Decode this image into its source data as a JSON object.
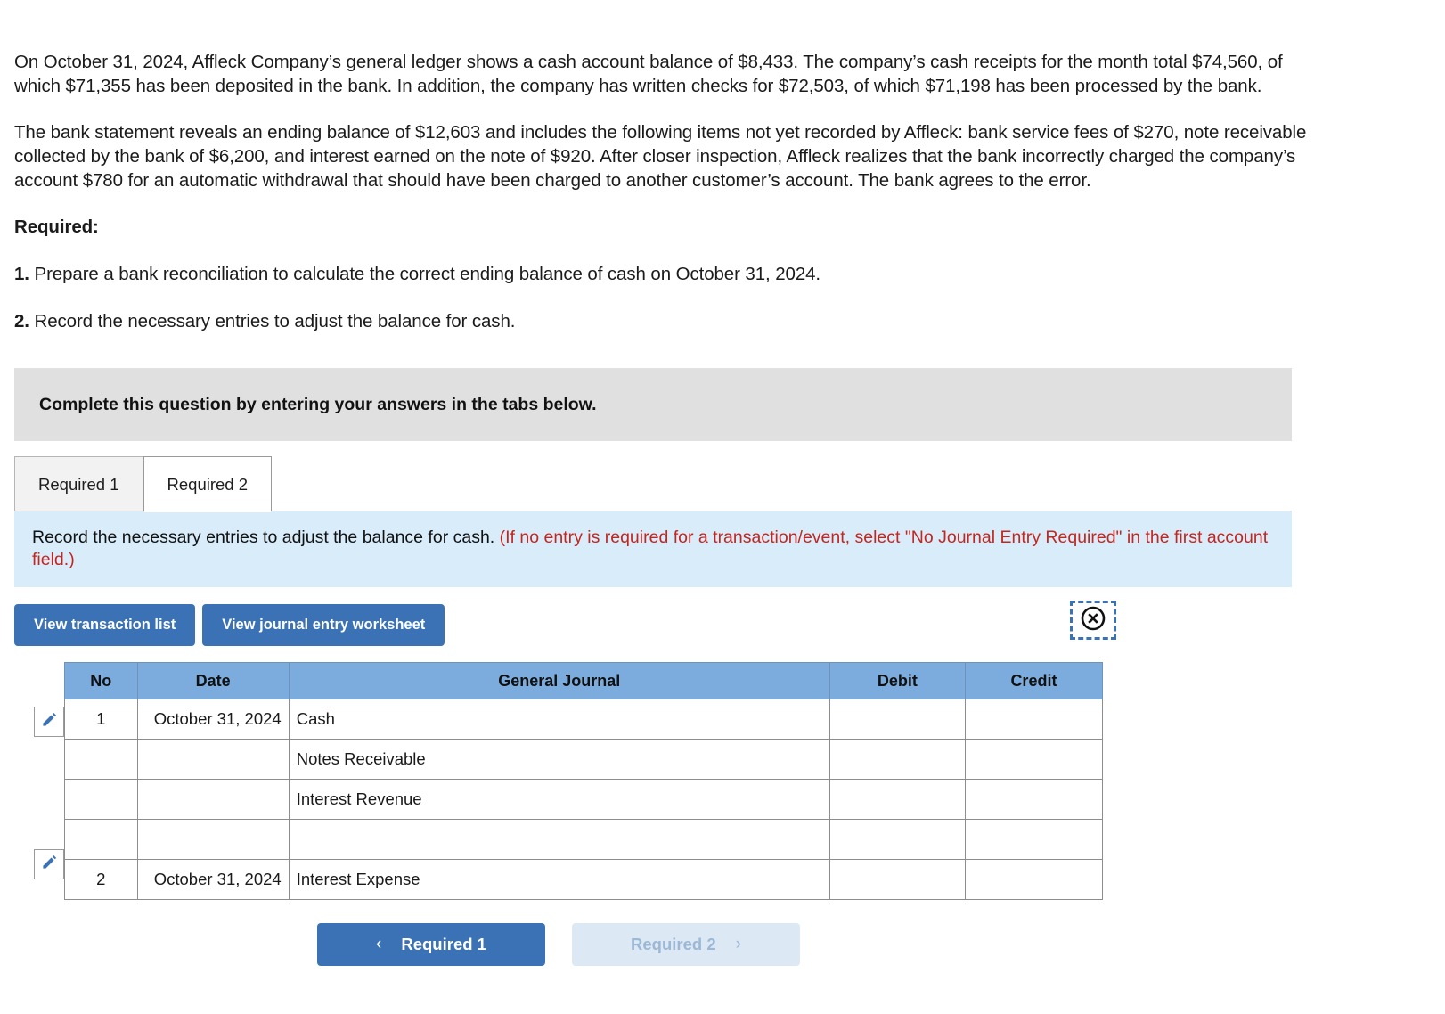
{
  "problem": {
    "paragraph_1": "On October 31, 2024, Affleck Company’s general ledger shows a cash account balance of $8,433. The company’s cash receipts for the month total $74,560, of which $71,355 has been deposited in the bank. In addition, the company has written checks for $72,503, of which $71,198 has been processed by the bank.",
    "paragraph_2": "The bank statement reveals an ending balance of $12,603 and includes the following items not yet recorded by Affleck: bank service fees of $270, note receivable collected by the bank of $6,200, and interest earned on the note of $920. After closer inspection, Affleck realizes that the bank incorrectly charged the company’s account $780 for an automatic withdrawal that should have been charged to another customer’s account. The bank agrees to the error.",
    "required_heading": "Required:",
    "requirement_1_number": "1.",
    "requirement_1_text": " Prepare a bank reconciliation to calculate the correct ending balance of cash on October 31, 2024.",
    "requirement_2_number": "2.",
    "requirement_2_text": " Record the necessary entries to adjust the balance for cash."
  },
  "banner": {
    "text": "Complete this question by entering your answers in the tabs below."
  },
  "tabs": [
    {
      "label": "Required 1",
      "active": false
    },
    {
      "label": "Required 2",
      "active": true
    }
  ],
  "instruction": {
    "main": "Record the necessary entries to adjust the balance for cash. ",
    "hint": "(If no entry is required for a transaction/event, select \"No Journal Entry Required\" in the first account field.)"
  },
  "toolbar": {
    "view_transaction_list": "View transaction list",
    "view_journal_entry_worksheet": "View journal entry worksheet",
    "close_icon_name": "circle-x-icon"
  },
  "journal_table": {
    "columns": [
      "No",
      "Date",
      "General Journal",
      "Debit",
      "Credit"
    ],
    "rows": [
      {
        "no": "1",
        "date": "October 31, 2024",
        "account": "Cash",
        "debit": "",
        "credit": "",
        "has_pencil": true
      },
      {
        "no": "",
        "date": "",
        "account": "Notes Receivable",
        "debit": "",
        "credit": "",
        "has_pencil": false
      },
      {
        "no": "",
        "date": "",
        "account": "Interest Revenue",
        "debit": "",
        "credit": "",
        "has_pencil": false
      },
      {
        "no": "",
        "date": "",
        "account": "",
        "debit": "",
        "credit": "",
        "has_pencil": false
      },
      {
        "no": "2",
        "date": "October 31, 2024",
        "account": "Interest Expense",
        "debit": "",
        "credit": "",
        "has_pencil": true
      }
    ]
  },
  "navigation": {
    "prev_label": "Required 1",
    "next_label": "Required 2",
    "prev_chevron": "‹",
    "next_chevron": "›"
  },
  "colors": {
    "primary_blue": "#3a72b5",
    "table_header_blue": "#7cacde",
    "instruction_blue": "#d9ecfa",
    "banner_grey": "#e0e0e0",
    "hint_red": "#c3261f"
  }
}
